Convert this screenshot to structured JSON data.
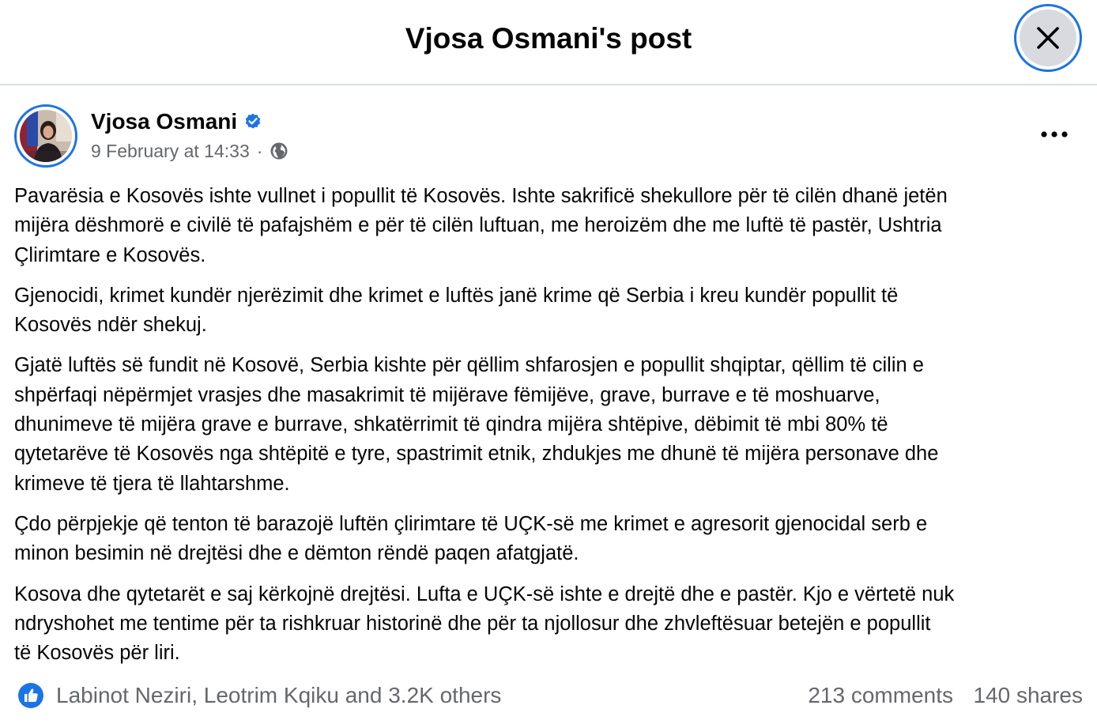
{
  "dialog": {
    "title": "Vjosa Osmani's post"
  },
  "post": {
    "author": "Vjosa Osmani",
    "date": "9 February at 14:33",
    "separator": "·",
    "paragraphs": [
      {
        "lines": [
          "Pavarësia e Kosovës ishte vullnet i popullit të Kosovës. Ishte sakrificë shekullore për të cilën dhanë jetën",
          "mijëra dëshmorë e civilë të pafajshëm e për të cilën luftuan, me heroizëm dhe me luftë të pastër, Ushtria",
          "Çlirimtare e Kosovës."
        ]
      },
      {
        "lines": [
          "Gjenocidi, krimet kundër njerëzimit dhe krimet e luftës janë krime që Serbia i kreu kundër popullit të",
          "Kosovës ndër shekuj."
        ]
      },
      {
        "lines": [
          "Gjatë luftës së fundit në Kosovë, Serbia kishte për qëllim shfarosjen e popullit shqiptar, qëllim të cilin e",
          "shpërfaqi nëpërmjet vrasjes dhe masakrimit të mijërave fëmijëve, grave, burrave e të moshuarve,",
          "dhunimeve të mijëra grave e burrave, shkatërrimit të qindra mijëra shtëpive, dëbimit të mbi 80% të",
          "qytetarëve të Kosovës nga shtëpitë e tyre, spastrimit etnik, zhdukjes me dhunë të mijëra personave dhe",
          "krimeve të tjera të llahtarshme."
        ]
      },
      {
        "lines": [
          "Çdo përpjekje që tenton të barazojë luftën çlirimtare të UÇK-së me krimet e agresorit gjenocidal serb e",
          "minon besimin në drejtësi dhe e dëmton rëndë paqen afatgjatë."
        ]
      },
      {
        "lines": [
          "Kosova dhe qytetarët e saj kërkojnë drejtësi. Lufta e UÇK-së ishte e drejtë dhe e pastër. Kjo e vërtetë nuk",
          "ndryshohet me tentime për ta rishkruar historinë dhe për ta njollosur dhe zhvleftësuar betejën e popullit",
          "të Kosovës për liri."
        ]
      }
    ]
  },
  "footer": {
    "reactors": "Labinot Neziri, Leotrim Kqiku and 3.2K others",
    "comments": "213 comments",
    "shares": "140 shares"
  },
  "icons": {
    "close": "close-icon",
    "verified": "verified-badge-icon",
    "audience": "globe-icon",
    "more": "more-options-icon",
    "like": "like-icon"
  },
  "colors": {
    "accent": "#1b74e4",
    "text_primary": "#050505",
    "text_secondary": "#65676b",
    "close_bg": "#d8dadf",
    "divider": "#dadde1"
  }
}
